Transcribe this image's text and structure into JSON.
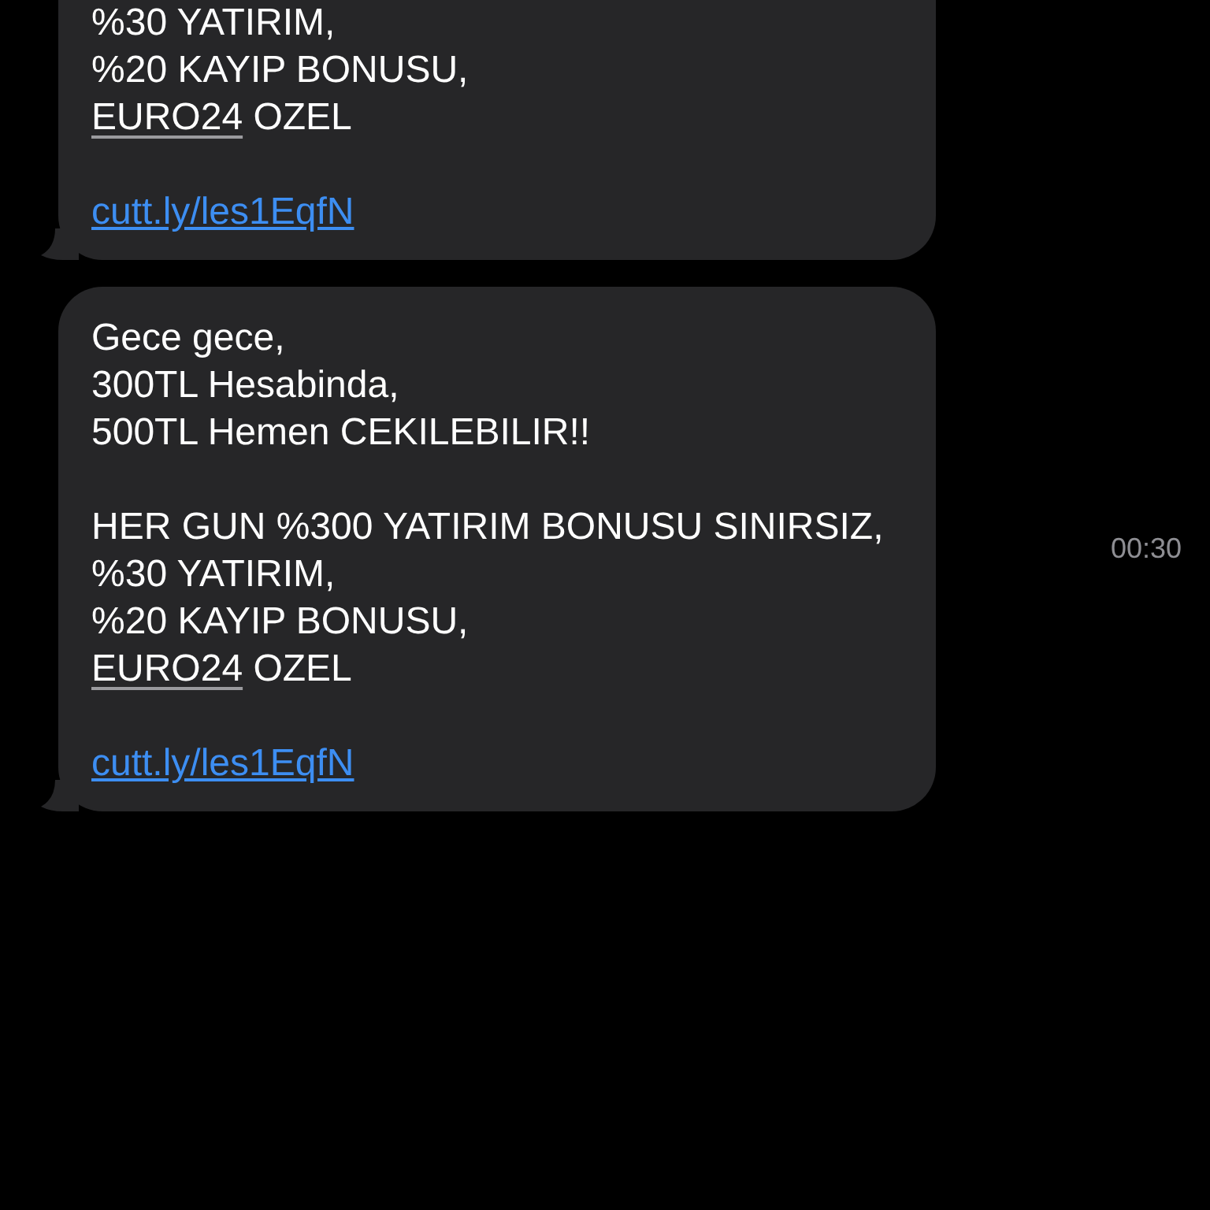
{
  "messages": [
    {
      "cut_top": true,
      "paragraphs": [
        [
          [
            {
              "kind": "text",
              "text": "%30 YATIRIM,"
            }
          ],
          [
            {
              "kind": "text",
              "text": "%20 KAYIP BONUSU,"
            }
          ],
          [
            {
              "kind": "detected",
              "text": "EURO24"
            },
            {
              "kind": "text",
              "text": " OZEL"
            }
          ]
        ],
        [
          [
            {
              "kind": "link",
              "text": "cutt.ly/les1EqfN"
            }
          ]
        ]
      ]
    },
    {
      "cut_top": false,
      "time": "00:30",
      "paragraphs": [
        [
          [
            {
              "kind": "text",
              "text": "Gece gece,"
            }
          ],
          [
            {
              "kind": "text",
              "text": "300TL Hesabinda,"
            }
          ],
          [
            {
              "kind": "text",
              "text": "500TL Hemen CEKILEBILIR!!"
            }
          ]
        ],
        [
          [
            {
              "kind": "text",
              "text": "HER GUN %300 YATIRIM BONUSU SINIRSIZ,"
            }
          ],
          [
            {
              "kind": "text",
              "text": "%30 YATIRIM,"
            }
          ],
          [
            {
              "kind": "text",
              "text": "%20 KAYIP BONUSU,"
            }
          ],
          [
            {
              "kind": "detected",
              "text": "EURO24"
            },
            {
              "kind": "text",
              "text": " OZEL"
            }
          ]
        ],
        [
          [
            {
              "kind": "link",
              "text": "cutt.ly/les1EqfN"
            }
          ]
        ]
      ]
    }
  ]
}
